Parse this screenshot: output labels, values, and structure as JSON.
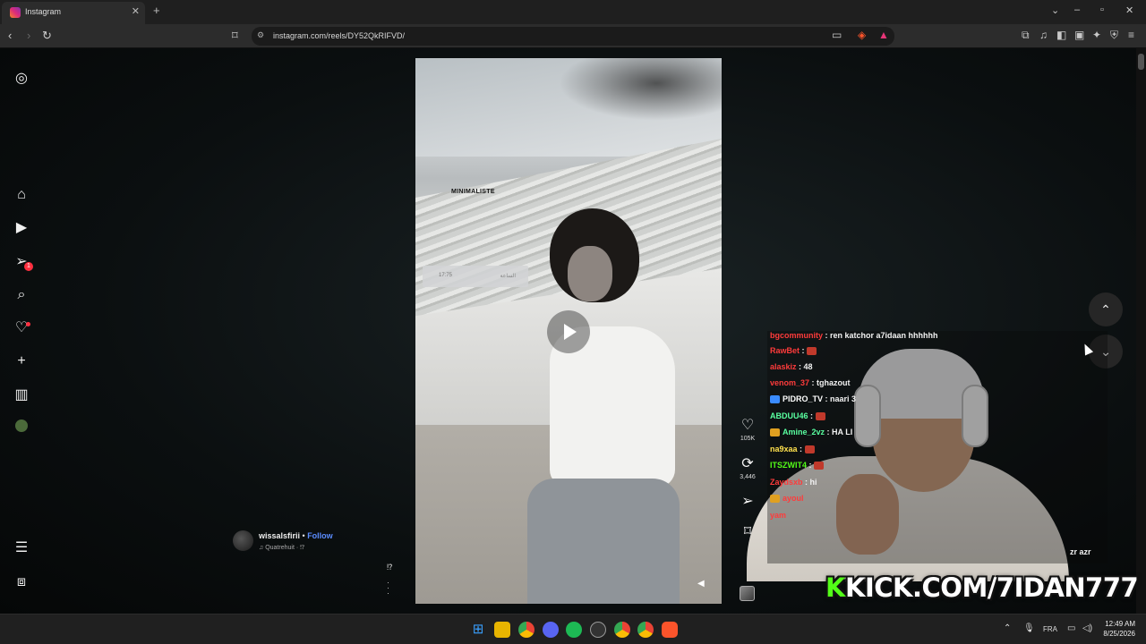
{
  "browser": {
    "tab_title": "Instagram",
    "url": "instagram.com/reels/DY52QkRIFVD/",
    "new_tab": "+",
    "tab_close": "✕"
  },
  "sidebar": {
    "notifications_badge": "1"
  },
  "reel": {
    "overlay_text": "MINIMALISTE",
    "phone_time": "17:75",
    "phone_label": "الساعة",
    "likes": "105K",
    "reposts": "3,446",
    "author": {
      "username": "wissalsfirii",
      "separator": " • ",
      "follow_label": "Follow",
      "audio": "Quatrehuit · ⁉︎"
    },
    "help_mark": "⁉︎",
    "more_dots": "·\n·\n·"
  },
  "chat": {
    "messages": [
      {
        "user": "bgcommunity",
        "text": " : ren katchor a7idaan hhhhhh",
        "color": "#ff3b3b"
      },
      {
        "user": "RawBet",
        "text": " : ",
        "color": "#ff3b3b",
        "emote": true
      },
      {
        "user": "alaskiz",
        "text": " : 48",
        "color": "#ff3b3b"
      },
      {
        "user": "venom_37",
        "text": " : tghazout",
        "color": "#ff3b3b"
      },
      {
        "user": "PIDRO_TV",
        "text": " : naari 3",
        "color": "#ffffff",
        "badge": "#3a8bff"
      },
      {
        "user": "ABDUU46",
        "text": " : ",
        "color": "#59ffa0",
        "emote": true
      },
      {
        "user": "Amine_2vz",
        "text": " : HA LI",
        "color": "#59ffa0",
        "badge": "#e0a020"
      },
      {
        "user": "na9xaa",
        "text": " : ",
        "color": "#ffe14d",
        "emote": true
      },
      {
        "user": "ITSZWIT4",
        "text": " : ",
        "color": "#53fc18",
        "emote": true
      },
      {
        "user": "Zaydsxb",
        "text": " : hi",
        "color": "#ff3b3b"
      },
      {
        "user": "ayoul",
        "text": "",
        "color": "#ff3b3b",
        "badge": "#e0a020"
      },
      {
        "user": "yam",
        "text": "",
        "color": "#ff3b3b"
      }
    ],
    "trailing": "zr azr"
  },
  "stream_overlay": {
    "kick_k": "K",
    "kick_rest": "KICK.COM/7IDAN777"
  },
  "taskbar": {
    "lang": "FRA",
    "time": "12:49 AM",
    "date": "8/25/2026"
  },
  "colors": {
    "follow": "#5b8cff",
    "badge": "#ff3040",
    "kick_green": "#53fc18"
  }
}
